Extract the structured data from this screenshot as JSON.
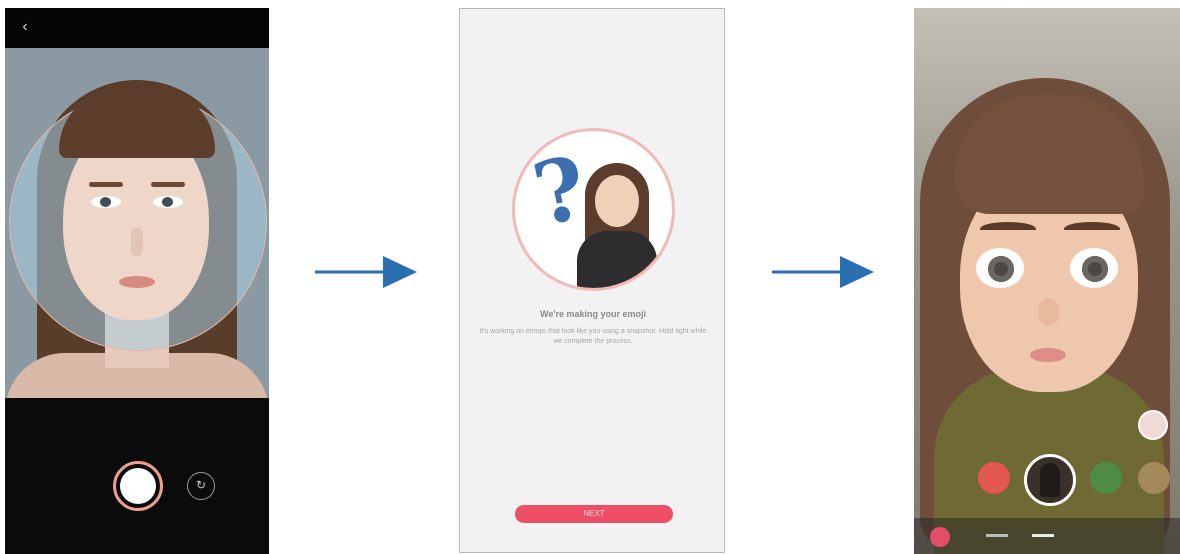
{
  "screens": {
    "capture": {
      "back_icon": "back-arrow-icon",
      "shutter_icon": "camera-shutter-icon",
      "switch_icon": "switch-camera-icon",
      "back_glyph": "‹",
      "switch_glyph": "↻"
    },
    "making": {
      "title": "We're making your emoji",
      "description": "It's working on emojis that look like you using a snapshot. Hold tight while we complete the process.",
      "button_label": "NEXT"
    },
    "emoji": {
      "bottom_icon": "emoji-app-icon"
    }
  },
  "flow": {
    "arrow_color": "#2b6fb3",
    "arrow_icon": "right-arrow-icon"
  },
  "colors": {
    "accent": "#ec4f66",
    "guide_ring": "#e2b9a7"
  }
}
